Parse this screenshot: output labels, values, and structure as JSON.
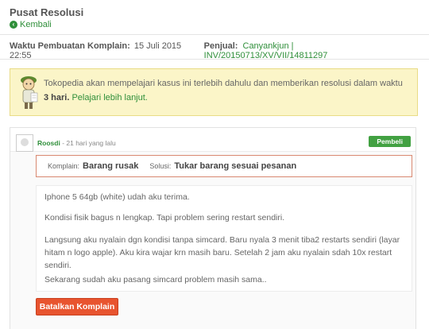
{
  "header": {
    "title": "Pusat Resolusi",
    "back_label": "Kembali"
  },
  "meta": {
    "created_label": "Waktu Pembuatan Komplain:",
    "created_value": "15 Juli 2015 22:55",
    "seller_label": "Penjual:",
    "seller_value": "Canyankjun | INV/20150713/XV/VII/14811297"
  },
  "notice": {
    "text_before": "Tokopedia akan mempelajari kasus ini terlebih dahulu dan memberikan resolusi dalam waktu ",
    "text_bold": "3 hari.",
    "link": "Pelajari lebih lanjut."
  },
  "thread": {
    "user_name": "Roosdi",
    "time": "- 21 hari yang lalu",
    "role": "Pembeli",
    "complaint_label": "Komplain:",
    "complaint_value": "Barang rusak",
    "solution_label": "Solusi:",
    "solution_value": "Tukar barang sesuai pesanan",
    "message": [
      "Iphone 5 64gb (white) udah aku terima.",
      "Kondisi fisik bagus n lengkap. Tapi problem sering restart sendiri.",
      "Langsung aku nyalain dgn kondisi tanpa simcard. Baru nyala 3 menit tiba2 restarts sendiri (layar hitam n logo apple). Aku kira wajar krn masih baru. Setelah 2 jam aku nyalain sdah 10x restart sendiri.",
      "Sekarang sudah aku pasang simcard problem masih sama.."
    ],
    "cancel_label": "Batalkan Komplain"
  }
}
